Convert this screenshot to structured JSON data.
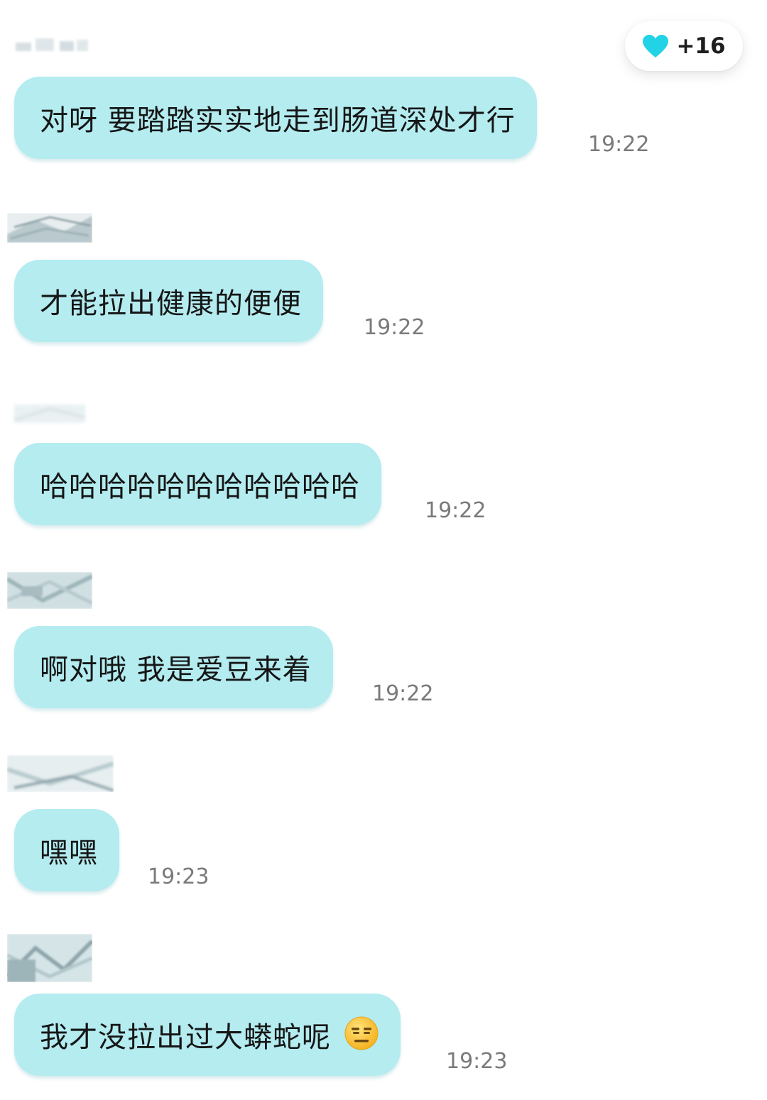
{
  "reaction": {
    "icon": "heart-icon",
    "color": "#22d3e6",
    "count": "+16"
  },
  "messages": [
    {
      "text": "对呀 要踏踏实实地走到肠道深处才行",
      "time": "19:22"
    },
    {
      "text": "才能拉出健康的便便",
      "time": "19:22"
    },
    {
      "text": "哈哈哈哈哈哈哈哈哈哈哈",
      "time": "19:22"
    },
    {
      "text": "啊对哦 我是爱豆来着",
      "time": "19:22"
    },
    {
      "text": "嘿嘿",
      "time": "19:23"
    },
    {
      "text": "我才没拉出过大蟒蛇呢",
      "time": "19:23",
      "emoji": "expressionless-face-emoji"
    }
  ],
  "colors": {
    "bubble": "#b4ecf0",
    "time": "#7a7a7a",
    "text": "#161616"
  }
}
